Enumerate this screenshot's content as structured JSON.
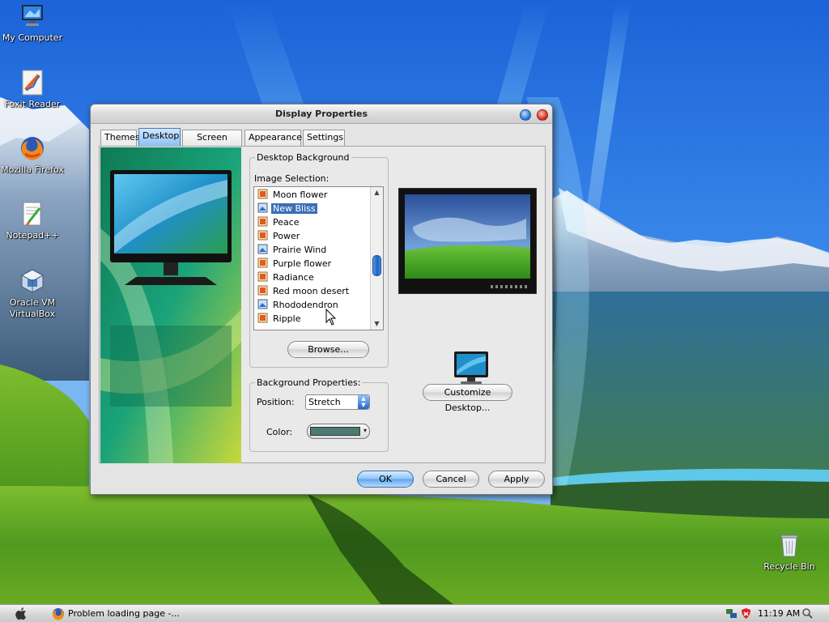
{
  "desktop": {
    "icons": [
      {
        "label": "My Computer",
        "icon": "monitor-icon"
      },
      {
        "label": "Foxit Reader",
        "icon": "pdf-reader-icon"
      },
      {
        "label": "Mozilla Firefox",
        "icon": "firefox-icon"
      },
      {
        "label": "Notepad++",
        "icon": "notepad-icon"
      },
      {
        "label": "Oracle VM VirtualBox",
        "icon": "virtualbox-icon"
      },
      {
        "label": "Recycle Bin",
        "icon": "recycle-bin-icon"
      }
    ]
  },
  "window": {
    "title": "Display Properties",
    "tabs": [
      {
        "label": "Themes"
      },
      {
        "label": "Desktop",
        "active": true
      },
      {
        "label": "Screen Saver"
      },
      {
        "label": "Appearance"
      },
      {
        "label": "Settings"
      }
    ],
    "desktop_background": {
      "legend": "Desktop Background",
      "image_selection_label": "Image Selection:",
      "items": [
        {
          "label": "Moon flower",
          "icon": "image-file-icon"
        },
        {
          "label": "New Bliss",
          "icon": "wallpaper-file-icon",
          "selected": true
        },
        {
          "label": "Peace",
          "icon": "image-file-icon"
        },
        {
          "label": "Power",
          "icon": "image-file-icon"
        },
        {
          "label": "Prairie Wind",
          "icon": "wallpaper-file-icon"
        },
        {
          "label": "Purple flower",
          "icon": "image-file-icon"
        },
        {
          "label": "Radiance",
          "icon": "image-file-icon"
        },
        {
          "label": "Red moon desert",
          "icon": "image-file-icon"
        },
        {
          "label": "Rhododendron",
          "icon": "wallpaper-file-icon"
        },
        {
          "label": "Ripple",
          "icon": "image-file-icon"
        }
      ],
      "browse_label": "Browse..."
    },
    "background_properties": {
      "legend": "Background Properties:",
      "position_label": "Position:",
      "position_value": "Stretch",
      "color_label": "Color:",
      "color_value": "#4a7a73"
    },
    "customize_label": "Customize Desktop...",
    "buttons": {
      "ok": "OK",
      "cancel": "Cancel",
      "apply": "Apply"
    }
  },
  "taskbar": {
    "task_label": "Problem loading page -...",
    "clock": "11:19 AM"
  },
  "colors": {
    "accent": "#3a6fb5",
    "selection": "#3a6fb5"
  }
}
